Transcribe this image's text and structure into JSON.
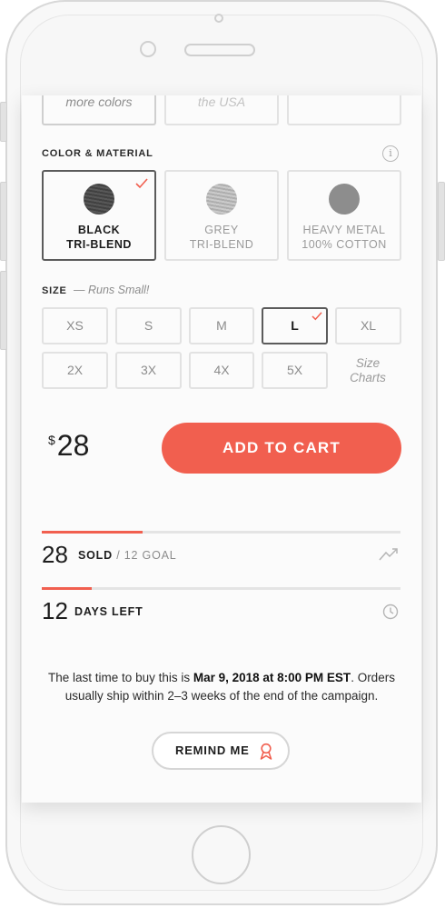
{
  "top_options": [
    {
      "label": "more colors"
    },
    {
      "label": "the USA"
    },
    {
      "label": ""
    }
  ],
  "color_material": {
    "heading": "COLOR & MATERIAL",
    "info_icon": "i",
    "options": [
      {
        "line1": "BLACK",
        "line2": "TRI-BLEND",
        "swatch": "#4a4a4a",
        "selected": true
      },
      {
        "line1": "GREY",
        "line2": "TRI-BLEND",
        "swatch": "#b9b9b9",
        "selected": false
      },
      {
        "line1": "HEAVY METAL",
        "line2": "100% COTTON",
        "swatch": "#8d8d8d",
        "selected": false
      }
    ]
  },
  "size": {
    "heading": "SIZE",
    "note": "— Runs Small!",
    "options": [
      "XS",
      "S",
      "M",
      "L",
      "XL",
      "2X",
      "3X",
      "4X",
      "5X"
    ],
    "selected": "L",
    "charts_link": "Size Charts"
  },
  "purchase": {
    "currency": "$",
    "price": "28",
    "add_to_cart": "ADD TO CART"
  },
  "stats": {
    "sold_count": "28",
    "sold_label": "SOLD",
    "goal_text": "/ 12 GOAL",
    "sold_progress": 0.28,
    "days_count": "12",
    "days_label": "DAYS LEFT",
    "days_progress": 0.14
  },
  "notice": {
    "before": "The last time to buy this is ",
    "date": "Mar 9, 2018 at 8:00 PM EST",
    "after": ". Orders usually ship within 2–3 weeks of the end of the campaign."
  },
  "remind": {
    "label": "REMIND ME"
  },
  "colors": {
    "accent": "#f15f4f",
    "selected_border": "#5b5b5b",
    "muted_border": "#e2e2e2"
  },
  "icons": {
    "check": "check-icon",
    "trend": "trend-icon",
    "clock": "clock-icon",
    "ribbon": "ribbon-icon",
    "info": "info-icon"
  }
}
